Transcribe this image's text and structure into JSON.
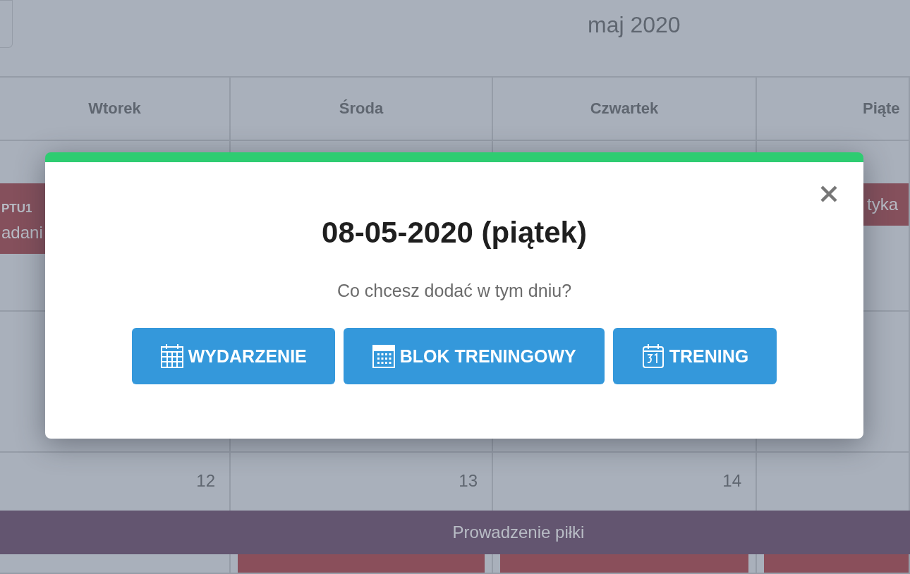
{
  "header": {
    "month": "maj 2020"
  },
  "weekdays": [
    "Wtorek",
    "Środa",
    "Czwartek",
    "Piąte"
  ],
  "week_1": {
    "column_1": {
      "events": [
        {
          "code": "PTU1",
          "title": "adani",
          "color": "#85505c"
        }
      ]
    },
    "column_4": {
      "events": [
        {
          "title": "tyka",
          "color": "#85505c"
        }
      ]
    }
  },
  "week_3": {
    "column_1": {
      "number": "12"
    },
    "column_2": {
      "number": "13",
      "events": [
        {
          "color": "#8a4f5b"
        }
      ]
    },
    "column_3": {
      "number": "14",
      "events": [
        {
          "color": "#8a4f5b"
        }
      ]
    },
    "column_4": {
      "events": [
        {
          "color": "#8a4f5b"
        }
      ]
    },
    "span_event": {
      "title": "Prowadzenie piłki",
      "color": "#635570"
    }
  },
  "modal": {
    "title": "08-05-2020 (piątek)",
    "prompt": "Co chcesz dodać w tym dniu?",
    "actions": [
      {
        "label": "WYDARZENIE",
        "kind": "event"
      },
      {
        "label": "BLOK TRENINGOWY",
        "kind": "block"
      },
      {
        "label": "TRENING",
        "kind": "training"
      }
    ]
  }
}
